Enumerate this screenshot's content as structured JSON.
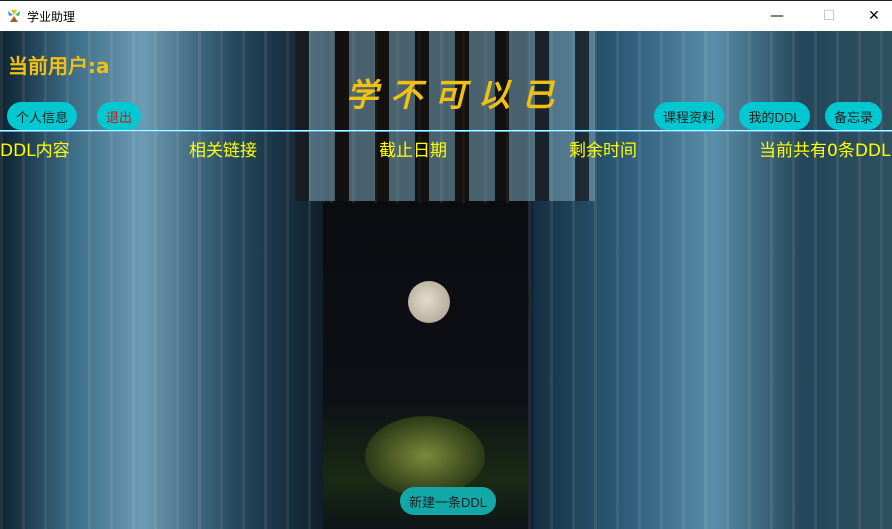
{
  "window": {
    "title": "学业助理",
    "minimize": "—",
    "maximize": "☐",
    "close": "✕"
  },
  "header": {
    "current_user": "当前用户:a",
    "motto": "学不可以已"
  },
  "nav_left": [
    {
      "label": "个人信息"
    },
    {
      "label": "退出"
    }
  ],
  "nav_right": [
    {
      "label": "课程资料"
    },
    {
      "label": "我的DDL"
    },
    {
      "label": "备忘录"
    }
  ],
  "table": {
    "headers": [
      "DDL内容",
      "相关链接",
      "截止日期",
      "剩余时间"
    ],
    "count_text": "当前共有0条DDL"
  },
  "actions": {
    "new_ddl": "新建一条DDL"
  },
  "colors": {
    "accent": "#00c8d0",
    "header_text": "#ffff00",
    "user_text": "#f2c010",
    "logout_text": "#ff0000"
  }
}
